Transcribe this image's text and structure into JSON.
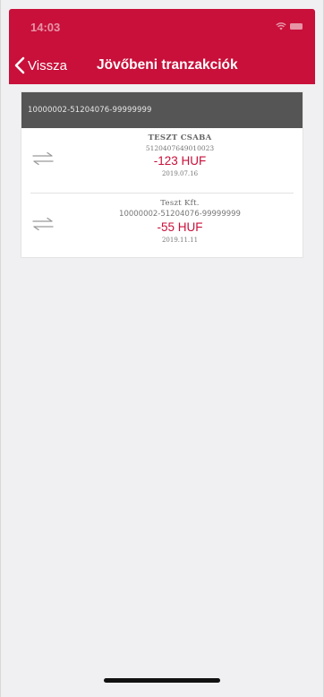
{
  "status_bar": {
    "time": "14:03",
    "icons": [
      "wifi-icon",
      "battery-icon"
    ]
  },
  "nav": {
    "back_label": "Vissza",
    "title": "Jövőbeni tranzakciók",
    "icons": [
      "chevron-left-icon"
    ]
  },
  "account": {
    "number": "10000002-51204076-99999999"
  },
  "transactions": [
    {
      "name": "TESZT CSABA",
      "account": "5120407649010023",
      "amount": "-123 HUF",
      "date": "2019.07.16",
      "icon": "transfer-icon"
    },
    {
      "name": "Teszt Kft.",
      "account": "10000002-51204076-99999999",
      "amount": "-55 HUF",
      "date": "2019.11.11",
      "icon": "transfer-icon"
    }
  ],
  "colors": {
    "brand": "#c8103a",
    "account_header": "#555555",
    "amount": "#c8103a",
    "background": "#f0f0f2"
  }
}
